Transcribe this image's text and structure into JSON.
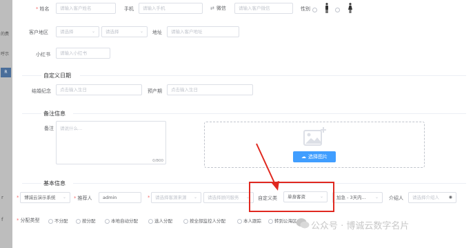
{
  "edge": {
    "text1": "的费",
    "text2": "呼示",
    "blue_text": "R",
    "mark1": "r",
    "mark2": "f"
  },
  "row1": {
    "name_label": "姓名",
    "name_placeholder": "请输入客户姓名",
    "phone_label": "手机",
    "phone_placeholder": "请输入手机",
    "wechat_label": "微信",
    "wechat_placeholder": "请输入客户微信",
    "gender_label": "性别"
  },
  "row2": {
    "region_label": "客户地区",
    "region_select1": "请选择",
    "region_select2": "请选择",
    "address_label": "地址",
    "address_placeholder": "请输入客户地址"
  },
  "row3": {
    "xhs_label": "小红书",
    "xhs_placeholder": "请输入小红书"
  },
  "custom_date": {
    "section_title": "自定义日期",
    "anniversary_label": "结婚纪念",
    "anniversary_placeholder": "点击输入生日",
    "due_label": "预产期",
    "due_placeholder": "点击输入生日"
  },
  "notes": {
    "section_title": "备注信息",
    "remark_label": "备注",
    "remark_placeholder": "请说什么...",
    "counter": "0/800",
    "upload_button": "选择图片"
  },
  "basic": {
    "section_title": "基本信息",
    "source_select": "博诚云演示系统",
    "referrer_label": "推荐人",
    "referrer_value": "admin",
    "channel_placeholder": "请选择客源来源",
    "advisor_placeholder": "请选择顾问服务",
    "custom_type_label": "自定义类",
    "custom_type_value": "单身客资",
    "followup_select": "加急 - 3天内...",
    "introducer_label": "介绍人",
    "introducer_placeholder": "请选择介绍人"
  },
  "assign": {
    "label": "分配类型",
    "options": [
      "不分配",
      "按分配",
      "本地自动分配",
      "选人分配",
      "按全部监控人分配",
      "本人跟踪",
      "转到公海区"
    ]
  },
  "watermark": {
    "text": "公众号 · 博诚云数字名片"
  },
  "colors": {
    "accent": "#409eff",
    "highlight_box": "#e0281f",
    "required": "#f56c6c"
  },
  "icons": {
    "caret": "chevron-down-icon",
    "exchange": "swap-icon",
    "male": "male-icon",
    "female": "female-icon",
    "image": "image-icon",
    "upload": "cloud-upload-icon",
    "wechat": "wechat-icon"
  }
}
